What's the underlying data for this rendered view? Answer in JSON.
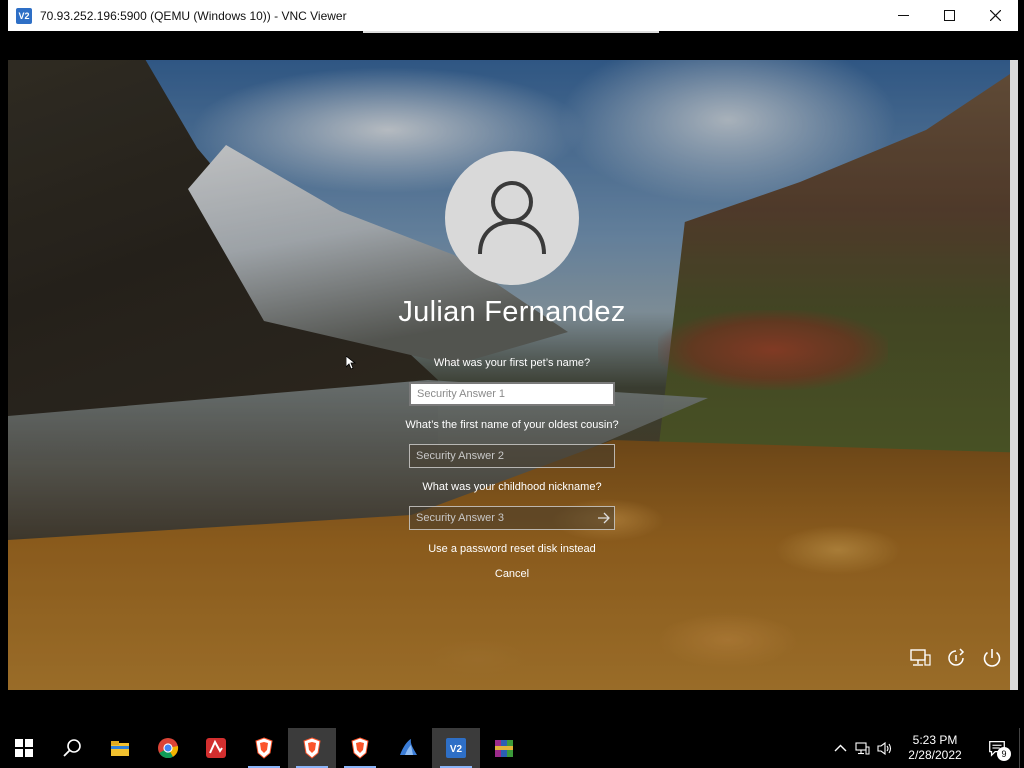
{
  "window": {
    "title": "70.93.252.196:5900 (QEMU (Windows 10)) - VNC Viewer",
    "logo_text": "V2"
  },
  "login": {
    "username": "Julian Fernandez",
    "questions": [
      {
        "question": "What was your first pet’s name?",
        "placeholder": "Security Answer 1"
      },
      {
        "question": "What’s the first name of your oldest cousin?",
        "placeholder": "Security Answer 2"
      },
      {
        "question": "What was your childhood nickname?",
        "placeholder": "Security Answer 3"
      }
    ],
    "reset_disk_link": "Use a password reset disk instead",
    "cancel_link": "Cancel"
  },
  "corner_icons": [
    "network-icon",
    "ease-of-access-icon",
    "power-icon"
  ],
  "taskbar": {
    "apps": [
      {
        "name": "file-explorer-icon",
        "color": "#f2c12e"
      },
      {
        "name": "chrome-icon",
        "color": "#4285f4"
      },
      {
        "name": "avira-icon",
        "color": "#d32f2f"
      },
      {
        "name": "brave-icon",
        "color": "#fb542b"
      },
      {
        "name": "brave-icon",
        "color": "#fb542b"
      },
      {
        "name": "brave-icon",
        "color": "#fb542b"
      },
      {
        "name": "bird-app-icon",
        "color": "#3b7dd8"
      },
      {
        "name": "vnc-viewer-icon",
        "color": "#2e6fc6"
      },
      {
        "name": "winrar-icon",
        "color": "#9c2b8a"
      }
    ],
    "clock_time": "5:23 PM",
    "clock_date": "2/28/2022",
    "notification_count": "9"
  }
}
